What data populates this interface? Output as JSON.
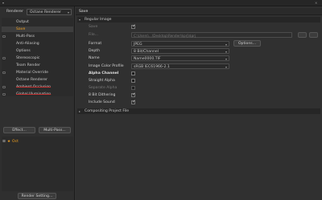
{
  "renderer": {
    "label": "Renderer",
    "value": "Octane Renderer"
  },
  "tree": [
    {
      "label": "Output",
      "checkbox": false,
      "selected": false,
      "struck": false
    },
    {
      "label": "Save",
      "checkbox": false,
      "selected": true,
      "struck": false
    },
    {
      "label": "Multi-Pass",
      "checkbox": true,
      "selected": false,
      "struck": false
    },
    {
      "label": "Anti-Aliasing",
      "checkbox": false,
      "selected": false,
      "struck": false
    },
    {
      "label": "Options",
      "checkbox": false,
      "selected": false,
      "struck": false
    },
    {
      "label": "Stereoscopic",
      "checkbox": true,
      "selected": false,
      "struck": false
    },
    {
      "label": "Team Render",
      "checkbox": false,
      "selected": false,
      "struck": false
    },
    {
      "label": "Material Override",
      "checkbox": true,
      "selected": false,
      "struck": false
    },
    {
      "label": "Octane Renderer",
      "checkbox": false,
      "selected": false,
      "struck": false
    },
    {
      "label": "Ambient Occlusion",
      "checkbox": true,
      "selected": false,
      "struck": true
    },
    {
      "label": "Global Illumination",
      "checkbox": true,
      "selected": false,
      "struck": true
    }
  ],
  "buttons": {
    "effect": "Effect...",
    "multipass": "Multi-Pass...",
    "render_setting": "Render Setting..."
  },
  "preset": {
    "name": "Oct",
    "accent": "#f0a020"
  },
  "tab": {
    "title": "Save"
  },
  "sections": {
    "regular": "Regular Image",
    "compositing": "Compositing Project File"
  },
  "fields": {
    "save_label": "Save",
    "file_label": "File...",
    "file_value": "C:\\Users\\...\\Desktop\\Render\\$prj\\$prj",
    "format_label": "Format",
    "format_value": "JPEG",
    "options_button": "Options...",
    "depth_label": "Depth",
    "depth_value": "8 Bit/Channel",
    "name_label": "Name",
    "name_value": "Name0000.TIF",
    "profile_label": "Image Color Profile",
    "profile_value": "sRGB IEC61966-2.1",
    "alpha_heading": "Alpha Channel",
    "straight_alpha": "Straight Alpha",
    "separate_alpha": "Separate Alpha",
    "dithering": "8 Bit Dithering",
    "include_sound": "Include Sound"
  },
  "colors": {
    "accent": "#f0a020",
    "strike": "#c03030"
  }
}
